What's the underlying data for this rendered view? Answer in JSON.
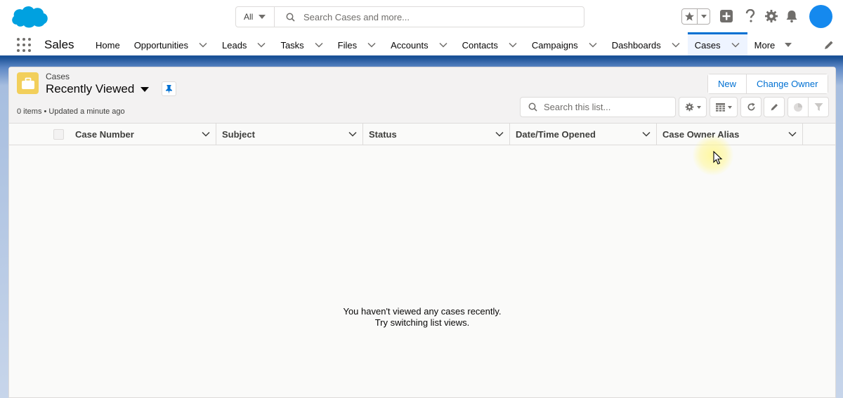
{
  "global_header": {
    "search_scope": "All",
    "search_placeholder": "Search Cases and more..."
  },
  "nav": {
    "app_name": "Sales",
    "items": [
      {
        "label": "Home",
        "has_menu": false
      },
      {
        "label": "Opportunities",
        "has_menu": true
      },
      {
        "label": "Leads",
        "has_menu": true
      },
      {
        "label": "Tasks",
        "has_menu": true
      },
      {
        "label": "Files",
        "has_menu": true
      },
      {
        "label": "Accounts",
        "has_menu": true
      },
      {
        "label": "Contacts",
        "has_menu": true
      },
      {
        "label": "Campaigns",
        "has_menu": true
      },
      {
        "label": "Dashboards",
        "has_menu": true
      },
      {
        "label": "Cases",
        "has_menu": true,
        "active": true
      }
    ],
    "more_label": "More"
  },
  "list_view": {
    "object_label": "Cases",
    "title": "Recently Viewed",
    "meta": "0 items • Updated a minute ago",
    "buttons": {
      "new": "New",
      "change_owner": "Change Owner"
    },
    "search_placeholder": "Search this list...",
    "columns": [
      "Case Number",
      "Subject",
      "Status",
      "Date/Time Opened",
      "Case Owner Alias"
    ],
    "empty_line1": "You haven't viewed any cases recently.",
    "empty_line2": "Try switching list views."
  },
  "colors": {
    "brand": "#0070d2",
    "nav_border": "#1b5297",
    "cases_icon": "#f2cf5b",
    "avatar": "#1589ee"
  }
}
